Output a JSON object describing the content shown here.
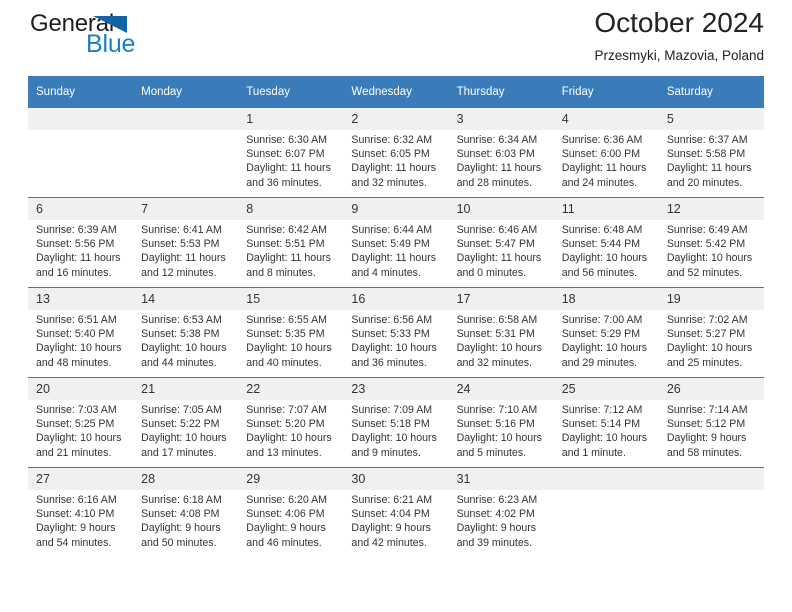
{
  "logo": {
    "word_top": "General",
    "word_bottom": "Blue",
    "triangle": "triangle-icon",
    "color_dark": "#231f20",
    "color_blue": "#1b7dc4",
    "color_triangle": "#1464a5"
  },
  "header": {
    "title": "October 2024",
    "subtitle": "Przesmyki, Mazovia, Poland"
  },
  "theme": {
    "header_row_bg": "#3a7cb9",
    "header_row_text": "#ffffff",
    "daynum_bg": "#f0f0f0",
    "grid_line": "#3a7cb9",
    "body_text": "#333333"
  },
  "weekdays": [
    "Sunday",
    "Monday",
    "Tuesday",
    "Wednesday",
    "Thursday",
    "Friday",
    "Saturday"
  ],
  "weeks": [
    [
      {
        "day": "",
        "empty": true,
        "sunrise": "",
        "sunset": "",
        "daylight1": "",
        "daylight2": ""
      },
      {
        "day": "",
        "empty": true,
        "sunrise": "",
        "sunset": "",
        "daylight1": "",
        "daylight2": ""
      },
      {
        "day": "1",
        "sunrise": "Sunrise: 6:30 AM",
        "sunset": "Sunset: 6:07 PM",
        "daylight1": "Daylight: 11 hours",
        "daylight2": "and 36 minutes."
      },
      {
        "day": "2",
        "sunrise": "Sunrise: 6:32 AM",
        "sunset": "Sunset: 6:05 PM",
        "daylight1": "Daylight: 11 hours",
        "daylight2": "and 32 minutes."
      },
      {
        "day": "3",
        "sunrise": "Sunrise: 6:34 AM",
        "sunset": "Sunset: 6:03 PM",
        "daylight1": "Daylight: 11 hours",
        "daylight2": "and 28 minutes."
      },
      {
        "day": "4",
        "sunrise": "Sunrise: 6:36 AM",
        "sunset": "Sunset: 6:00 PM",
        "daylight1": "Daylight: 11 hours",
        "daylight2": "and 24 minutes."
      },
      {
        "day": "5",
        "sunrise": "Sunrise: 6:37 AM",
        "sunset": "Sunset: 5:58 PM",
        "daylight1": "Daylight: 11 hours",
        "daylight2": "and 20 minutes."
      }
    ],
    [
      {
        "day": "6",
        "sunrise": "Sunrise: 6:39 AM",
        "sunset": "Sunset: 5:56 PM",
        "daylight1": "Daylight: 11 hours",
        "daylight2": "and 16 minutes."
      },
      {
        "day": "7",
        "sunrise": "Sunrise: 6:41 AM",
        "sunset": "Sunset: 5:53 PM",
        "daylight1": "Daylight: 11 hours",
        "daylight2": "and 12 minutes."
      },
      {
        "day": "8",
        "sunrise": "Sunrise: 6:42 AM",
        "sunset": "Sunset: 5:51 PM",
        "daylight1": "Daylight: 11 hours",
        "daylight2": "and 8 minutes."
      },
      {
        "day": "9",
        "sunrise": "Sunrise: 6:44 AM",
        "sunset": "Sunset: 5:49 PM",
        "daylight1": "Daylight: 11 hours",
        "daylight2": "and 4 minutes."
      },
      {
        "day": "10",
        "sunrise": "Sunrise: 6:46 AM",
        "sunset": "Sunset: 5:47 PM",
        "daylight1": "Daylight: 11 hours",
        "daylight2": "and 0 minutes."
      },
      {
        "day": "11",
        "sunrise": "Sunrise: 6:48 AM",
        "sunset": "Sunset: 5:44 PM",
        "daylight1": "Daylight: 10 hours",
        "daylight2": "and 56 minutes."
      },
      {
        "day": "12",
        "sunrise": "Sunrise: 6:49 AM",
        "sunset": "Sunset: 5:42 PM",
        "daylight1": "Daylight: 10 hours",
        "daylight2": "and 52 minutes."
      }
    ],
    [
      {
        "day": "13",
        "sunrise": "Sunrise: 6:51 AM",
        "sunset": "Sunset: 5:40 PM",
        "daylight1": "Daylight: 10 hours",
        "daylight2": "and 48 minutes."
      },
      {
        "day": "14",
        "sunrise": "Sunrise: 6:53 AM",
        "sunset": "Sunset: 5:38 PM",
        "daylight1": "Daylight: 10 hours",
        "daylight2": "and 44 minutes."
      },
      {
        "day": "15",
        "sunrise": "Sunrise: 6:55 AM",
        "sunset": "Sunset: 5:35 PM",
        "daylight1": "Daylight: 10 hours",
        "daylight2": "and 40 minutes."
      },
      {
        "day": "16",
        "sunrise": "Sunrise: 6:56 AM",
        "sunset": "Sunset: 5:33 PM",
        "daylight1": "Daylight: 10 hours",
        "daylight2": "and 36 minutes."
      },
      {
        "day": "17",
        "sunrise": "Sunrise: 6:58 AM",
        "sunset": "Sunset: 5:31 PM",
        "daylight1": "Daylight: 10 hours",
        "daylight2": "and 32 minutes."
      },
      {
        "day": "18",
        "sunrise": "Sunrise: 7:00 AM",
        "sunset": "Sunset: 5:29 PM",
        "daylight1": "Daylight: 10 hours",
        "daylight2": "and 29 minutes."
      },
      {
        "day": "19",
        "sunrise": "Sunrise: 7:02 AM",
        "sunset": "Sunset: 5:27 PM",
        "daylight1": "Daylight: 10 hours",
        "daylight2": "and 25 minutes."
      }
    ],
    [
      {
        "day": "20",
        "sunrise": "Sunrise: 7:03 AM",
        "sunset": "Sunset: 5:25 PM",
        "daylight1": "Daylight: 10 hours",
        "daylight2": "and 21 minutes."
      },
      {
        "day": "21",
        "sunrise": "Sunrise: 7:05 AM",
        "sunset": "Sunset: 5:22 PM",
        "daylight1": "Daylight: 10 hours",
        "daylight2": "and 17 minutes."
      },
      {
        "day": "22",
        "sunrise": "Sunrise: 7:07 AM",
        "sunset": "Sunset: 5:20 PM",
        "daylight1": "Daylight: 10 hours",
        "daylight2": "and 13 minutes."
      },
      {
        "day": "23",
        "sunrise": "Sunrise: 7:09 AM",
        "sunset": "Sunset: 5:18 PM",
        "daylight1": "Daylight: 10 hours",
        "daylight2": "and 9 minutes."
      },
      {
        "day": "24",
        "sunrise": "Sunrise: 7:10 AM",
        "sunset": "Sunset: 5:16 PM",
        "daylight1": "Daylight: 10 hours",
        "daylight2": "and 5 minutes."
      },
      {
        "day": "25",
        "sunrise": "Sunrise: 7:12 AM",
        "sunset": "Sunset: 5:14 PM",
        "daylight1": "Daylight: 10 hours",
        "daylight2": "and 1 minute."
      },
      {
        "day": "26",
        "sunrise": "Sunrise: 7:14 AM",
        "sunset": "Sunset: 5:12 PM",
        "daylight1": "Daylight: 9 hours",
        "daylight2": "and 58 minutes."
      }
    ],
    [
      {
        "day": "27",
        "sunrise": "Sunrise: 6:16 AM",
        "sunset": "Sunset: 4:10 PM",
        "daylight1": "Daylight: 9 hours",
        "daylight2": "and 54 minutes."
      },
      {
        "day": "28",
        "sunrise": "Sunrise: 6:18 AM",
        "sunset": "Sunset: 4:08 PM",
        "daylight1": "Daylight: 9 hours",
        "daylight2": "and 50 minutes."
      },
      {
        "day": "29",
        "sunrise": "Sunrise: 6:20 AM",
        "sunset": "Sunset: 4:06 PM",
        "daylight1": "Daylight: 9 hours",
        "daylight2": "and 46 minutes."
      },
      {
        "day": "30",
        "sunrise": "Sunrise: 6:21 AM",
        "sunset": "Sunset: 4:04 PM",
        "daylight1": "Daylight: 9 hours",
        "daylight2": "and 42 minutes."
      },
      {
        "day": "31",
        "sunrise": "Sunrise: 6:23 AM",
        "sunset": "Sunset: 4:02 PM",
        "daylight1": "Daylight: 9 hours",
        "daylight2": "and 39 minutes."
      },
      {
        "day": "",
        "empty": true,
        "sunrise": "",
        "sunset": "",
        "daylight1": "",
        "daylight2": ""
      },
      {
        "day": "",
        "empty": true,
        "sunrise": "",
        "sunset": "",
        "daylight1": "",
        "daylight2": ""
      }
    ]
  ]
}
